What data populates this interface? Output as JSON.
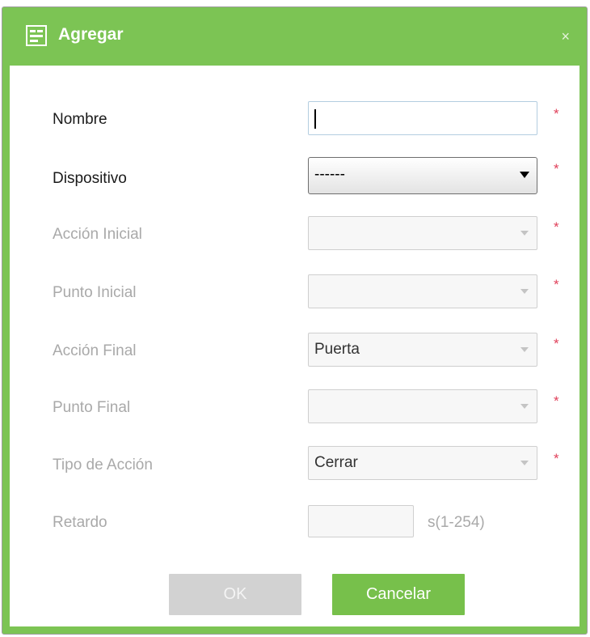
{
  "dialog": {
    "title": "Agregar",
    "close_symbol": "×",
    "accent_color": "#7cc454",
    "title_icon": "form-icon"
  },
  "form": {
    "nombre": {
      "label": "Nombre",
      "value": ""
    },
    "dispositivo": {
      "label": "Dispositivo",
      "value": "------"
    },
    "accion_inicial": {
      "label": "Acción Inicial",
      "value": ""
    },
    "punto_inicial": {
      "label": "Punto Inicial",
      "value": ""
    },
    "accion_final": {
      "label": "Acción Final",
      "value": "Puerta"
    },
    "punto_final": {
      "label": "Punto Final",
      "value": ""
    },
    "tipo_accion": {
      "label": "Tipo de Acción",
      "value": "Cerrar"
    },
    "retardo": {
      "label": "Retardo",
      "value": "",
      "hint": "s(1-254)"
    },
    "required_mark": "*"
  },
  "buttons": {
    "ok": "OK",
    "cancel": "Cancelar"
  }
}
